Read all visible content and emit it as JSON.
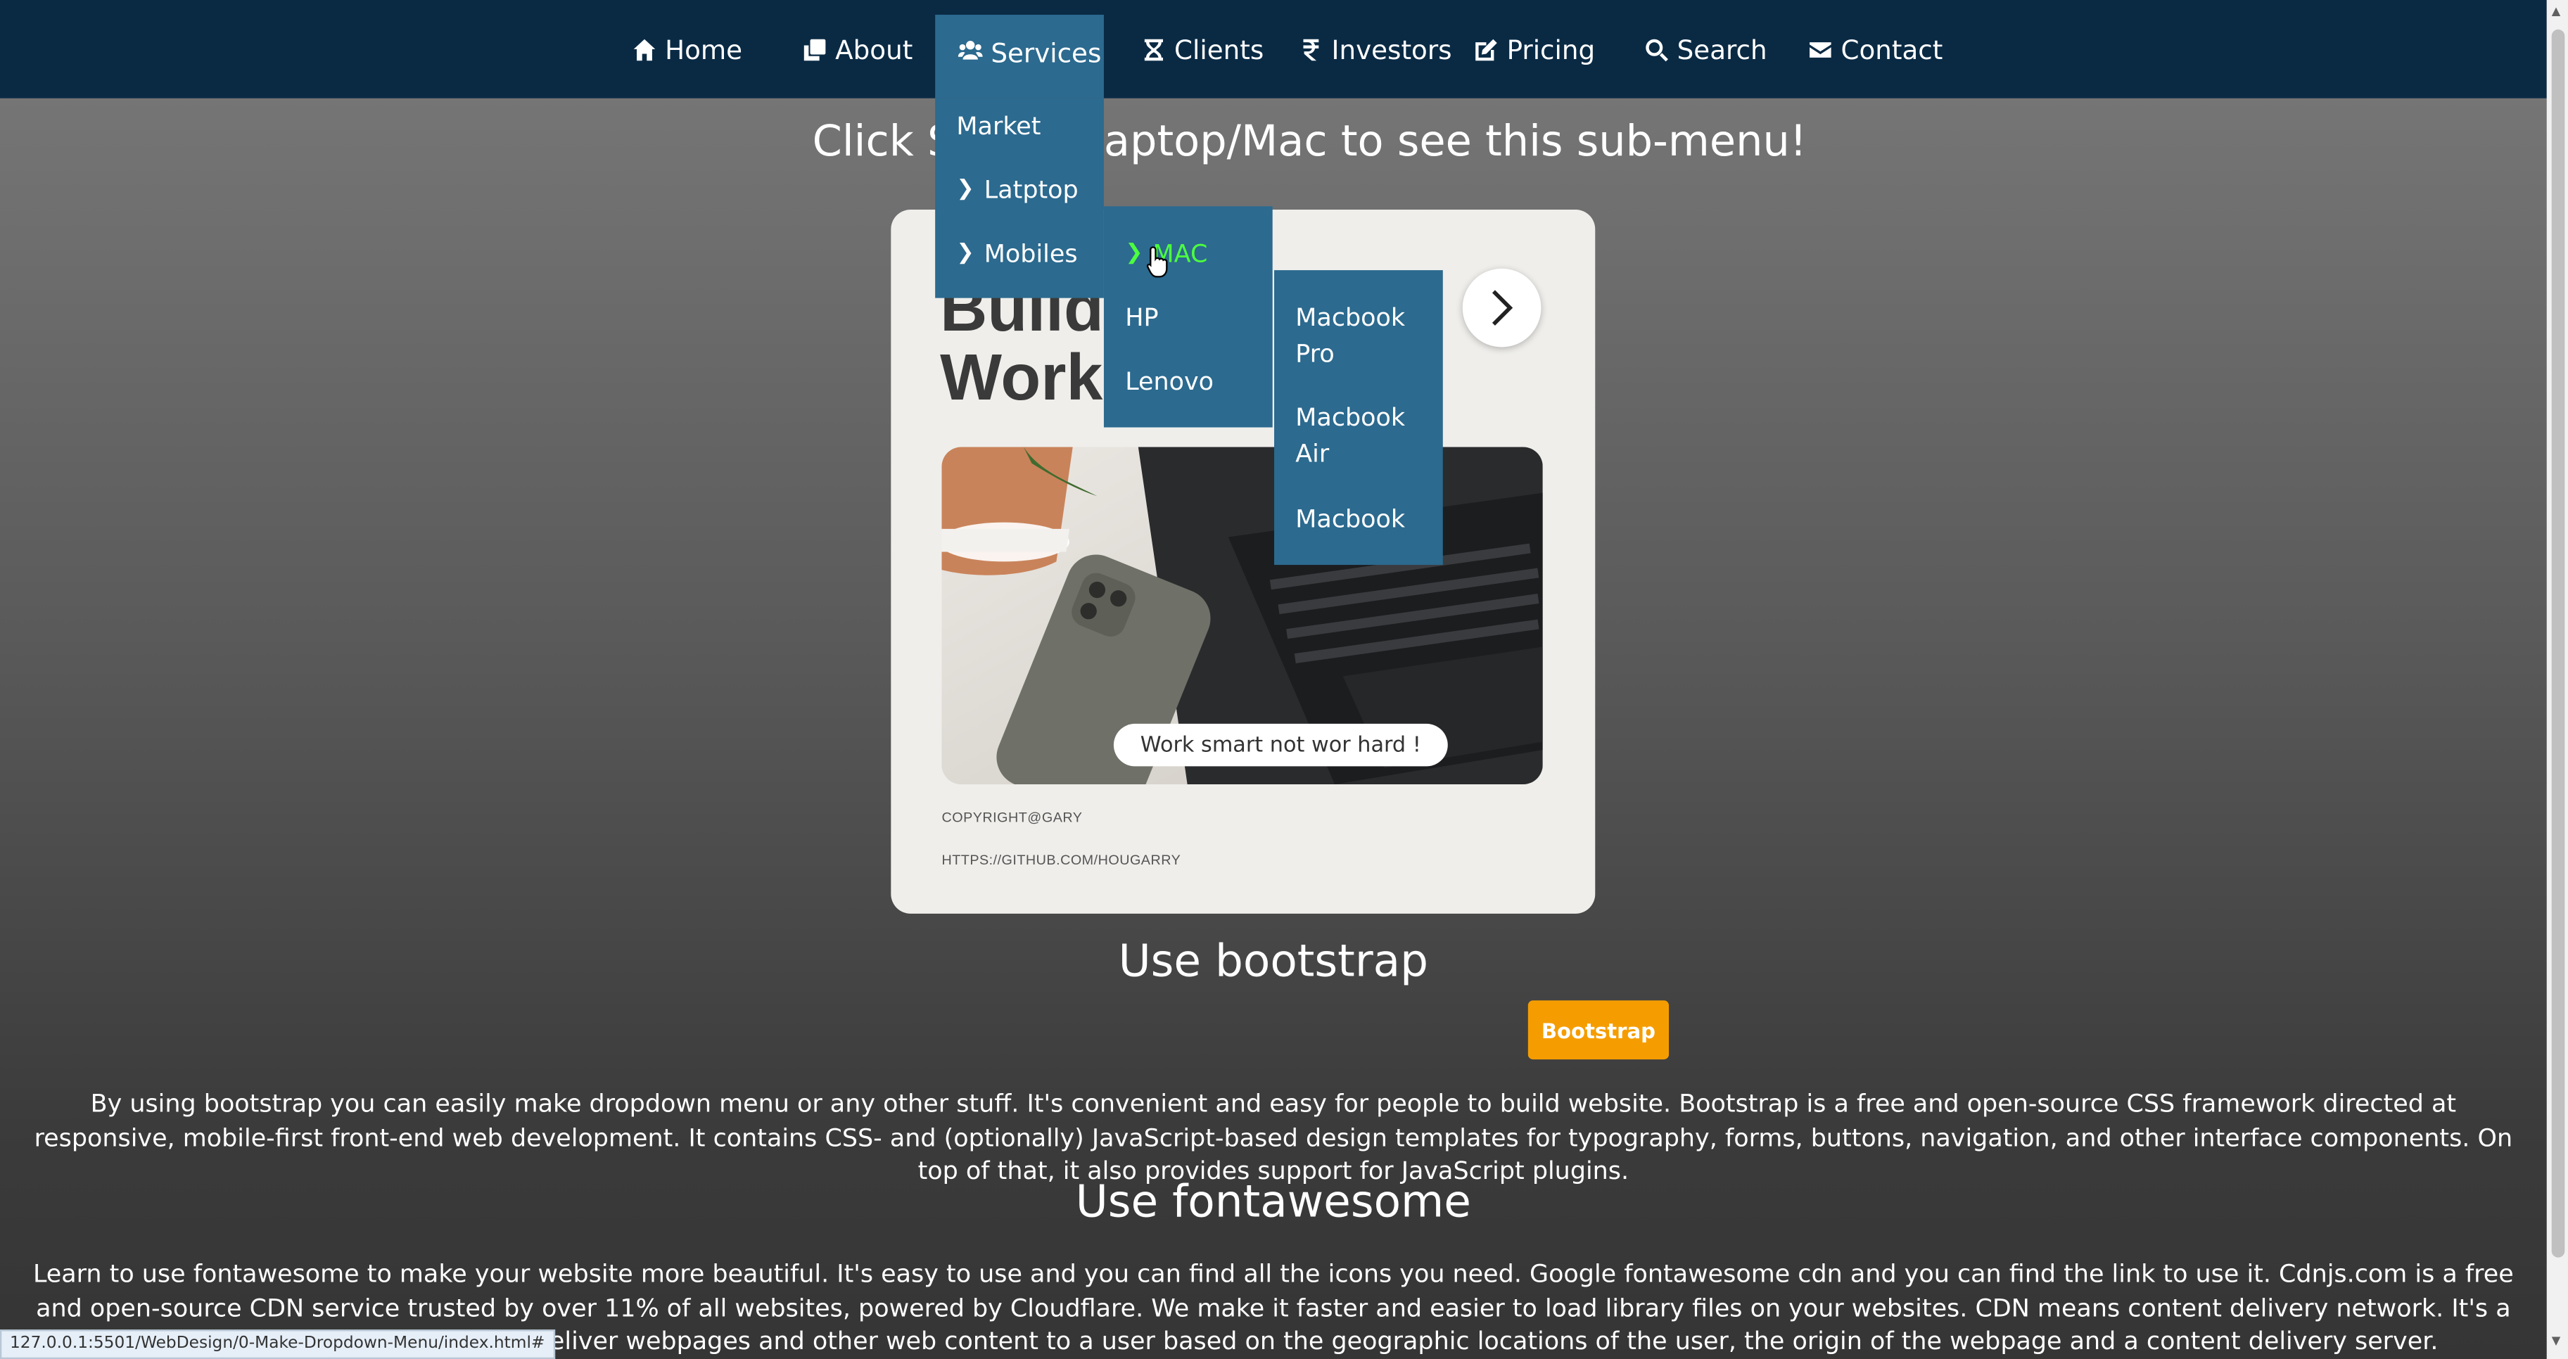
{
  "nav": {
    "items": [
      {
        "label": "Home",
        "icon": "home-icon"
      },
      {
        "label": "About",
        "icon": "clone-icon"
      },
      {
        "label": "Services",
        "icon": "users-icon"
      },
      {
        "label": "Clients",
        "icon": "hourglass-icon"
      },
      {
        "label": "Investors",
        "icon": "rupee-icon"
      },
      {
        "label": "Pricing",
        "icon": "edit-icon"
      },
      {
        "label": "Search",
        "icon": "search-icon"
      },
      {
        "label": "Contact",
        "icon": "envelope-icon"
      }
    ],
    "active": "Services"
  },
  "services_menu": {
    "items": [
      {
        "label": "Market"
      },
      {
        "label": "Latptop"
      },
      {
        "label": "Mobiles"
      }
    ]
  },
  "laptop_menu": {
    "items": [
      {
        "label": "MAC"
      },
      {
        "label": "HP"
      },
      {
        "label": "Lenovo"
      }
    ]
  },
  "mac_menu": {
    "items": [
      {
        "label": "Macbook Pro"
      },
      {
        "label": "Macbook Air"
      },
      {
        "label": "Macbook"
      }
    ]
  },
  "headline": {
    "left": "Click S",
    "right": "aptop/Mac to see this sub-menu!"
  },
  "card": {
    "title_line1": "Build",
    "title_line2": "Work",
    "caption": "Work smart not wor hard !",
    "copyright": "COPYRIGHT@GARY",
    "github": "HTTPS://GITHUB.COM/HOUGARRY"
  },
  "bootstrap": {
    "title": "Use bootstrap",
    "button": "Bootstrap",
    "text": "By using bootstrap you can easily make dropdown menu or any other stuff. It's convenient and easy for people to build website. Bootstrap is a free and open-source CSS framework directed at responsive, mobile-first front-end web development. It contains CSS- and (optionally) JavaScript-based design templates for typography, forms, buttons, navigation, and other interface components. On top of that, it also provides support for JavaScript plugins."
  },
  "fontawesome": {
    "title": "Use fontawesome",
    "text": "Learn to use fontawesome to make your website more beautiful. It's easy to use and you can find all the icons you need. Google fontawesome cdn and you can find the link to use it. Cdnjs.com is a free and open-source CDN service trusted by over 11% of all websites, powered by Cloudflare. We make it faster and easier to load library files on your websites. CDN means content delivery network. It's a system of distributed servers that deliver webpages and other web content to a user based on the geographic locations of the user, the origin of the webpage and a content delivery server."
  },
  "status_url": "127.0.0.1:5501/WebDesign/0-Make-Dropdown-Menu/index.html#",
  "colors": {
    "nav_bg": "#0a2a44",
    "menu_bg": "#2c6a8f",
    "hover_text": "#4cff3f",
    "button_orange": "#f59d00"
  }
}
